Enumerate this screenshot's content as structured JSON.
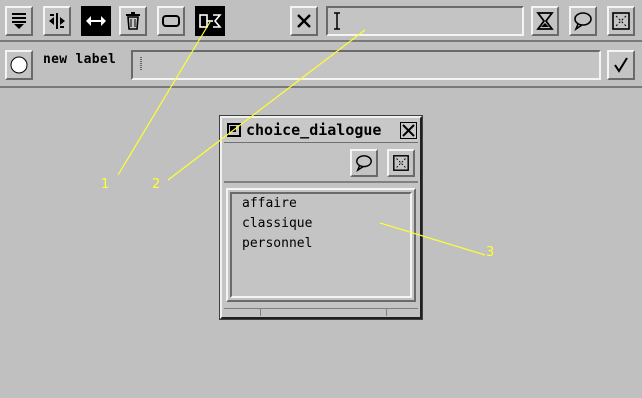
{
  "toolbar": {
    "icons": [
      "list-menu-icon",
      "split-arrows-icon",
      "horizontal-arrows-icon",
      "trash-icon",
      "rounded-rect-icon",
      "bind-icon",
      "close-icon",
      "text-cursor-icon",
      "hourglass-icon",
      "speech-bubble-icon",
      "resize-box-icon"
    ]
  },
  "label_bar": {
    "label": "new label",
    "input_value": ""
  },
  "dialog": {
    "title": "choice_dialogue",
    "items": [
      "affaire",
      "classique",
      "personnel"
    ]
  },
  "annotations": [
    "1",
    "2",
    "3"
  ],
  "colors": {
    "background": "#c0c0c0",
    "annotation": "#ffff30",
    "dark_button": "#000000"
  }
}
